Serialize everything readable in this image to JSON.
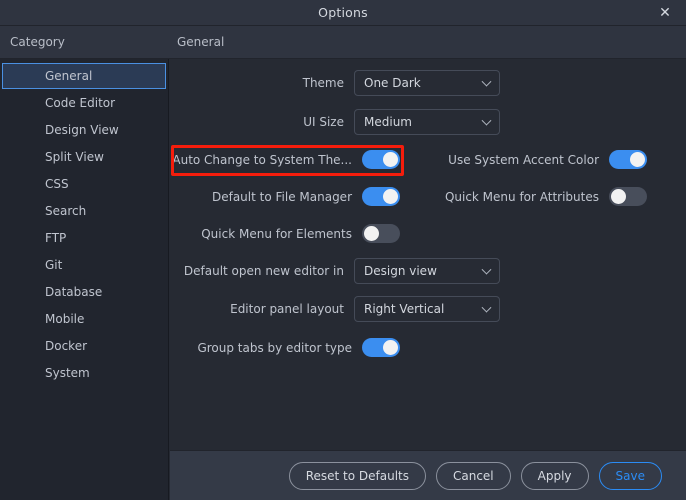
{
  "window": {
    "title": "Options",
    "close_icon": "close-icon"
  },
  "header": {
    "category_label": "Category",
    "section_label": "General"
  },
  "sidebar": {
    "items": [
      {
        "label": "General",
        "selected": true
      },
      {
        "label": "Code Editor",
        "selected": false
      },
      {
        "label": "Design View",
        "selected": false
      },
      {
        "label": "Split View",
        "selected": false
      },
      {
        "label": "CSS",
        "selected": false
      },
      {
        "label": "Search",
        "selected": false
      },
      {
        "label": "FTP",
        "selected": false
      },
      {
        "label": "Git",
        "selected": false
      },
      {
        "label": "Database",
        "selected": false
      },
      {
        "label": "Mobile",
        "selected": false
      },
      {
        "label": "Docker",
        "selected": false
      },
      {
        "label": "System",
        "selected": false
      }
    ]
  },
  "settings": {
    "theme": {
      "label": "Theme",
      "value": "One Dark",
      "chevron_icon": "chevron-down-icon"
    },
    "ui_size": {
      "label": "UI Size",
      "value": "Medium",
      "chevron_icon": "chevron-down-icon"
    },
    "auto_change_system_theme": {
      "label": "Auto Change to System The...",
      "state": "on"
    },
    "use_system_accent_color": {
      "label": "Use System Accent Color",
      "state": "on"
    },
    "default_to_file_manager": {
      "label": "Default to File Manager",
      "state": "on"
    },
    "quick_menu_for_attributes": {
      "label": "Quick Menu for Attributes",
      "state": "off"
    },
    "quick_menu_for_elements": {
      "label": "Quick Menu for Elements",
      "state": "off"
    },
    "default_open_new_editor_in": {
      "label": "Default open new editor in",
      "value": "Design view",
      "chevron_icon": "chevron-down-icon"
    },
    "editor_panel_layout": {
      "label": "Editor panel layout",
      "value": "Right Vertical",
      "chevron_icon": "chevron-down-icon"
    },
    "group_tabs_by_editor_type": {
      "label": "Group tabs by editor type",
      "state": "on"
    }
  },
  "footer": {
    "reset_label": "Reset to Defaults",
    "cancel_label": "Cancel",
    "apply_label": "Apply",
    "save_label": "Save"
  },
  "annotation": {
    "highlight_color": "#f51d0c",
    "target": "auto_change_system_theme"
  },
  "colors": {
    "accent": "#3b8ef0",
    "titlebar_bg": "#2f3440",
    "sidebar_bg": "#21252e",
    "main_bg": "#262a33",
    "footer_bg": "#343a47",
    "selected_item_bg": "#2b3b55",
    "selected_item_border": "#4a90e2"
  }
}
